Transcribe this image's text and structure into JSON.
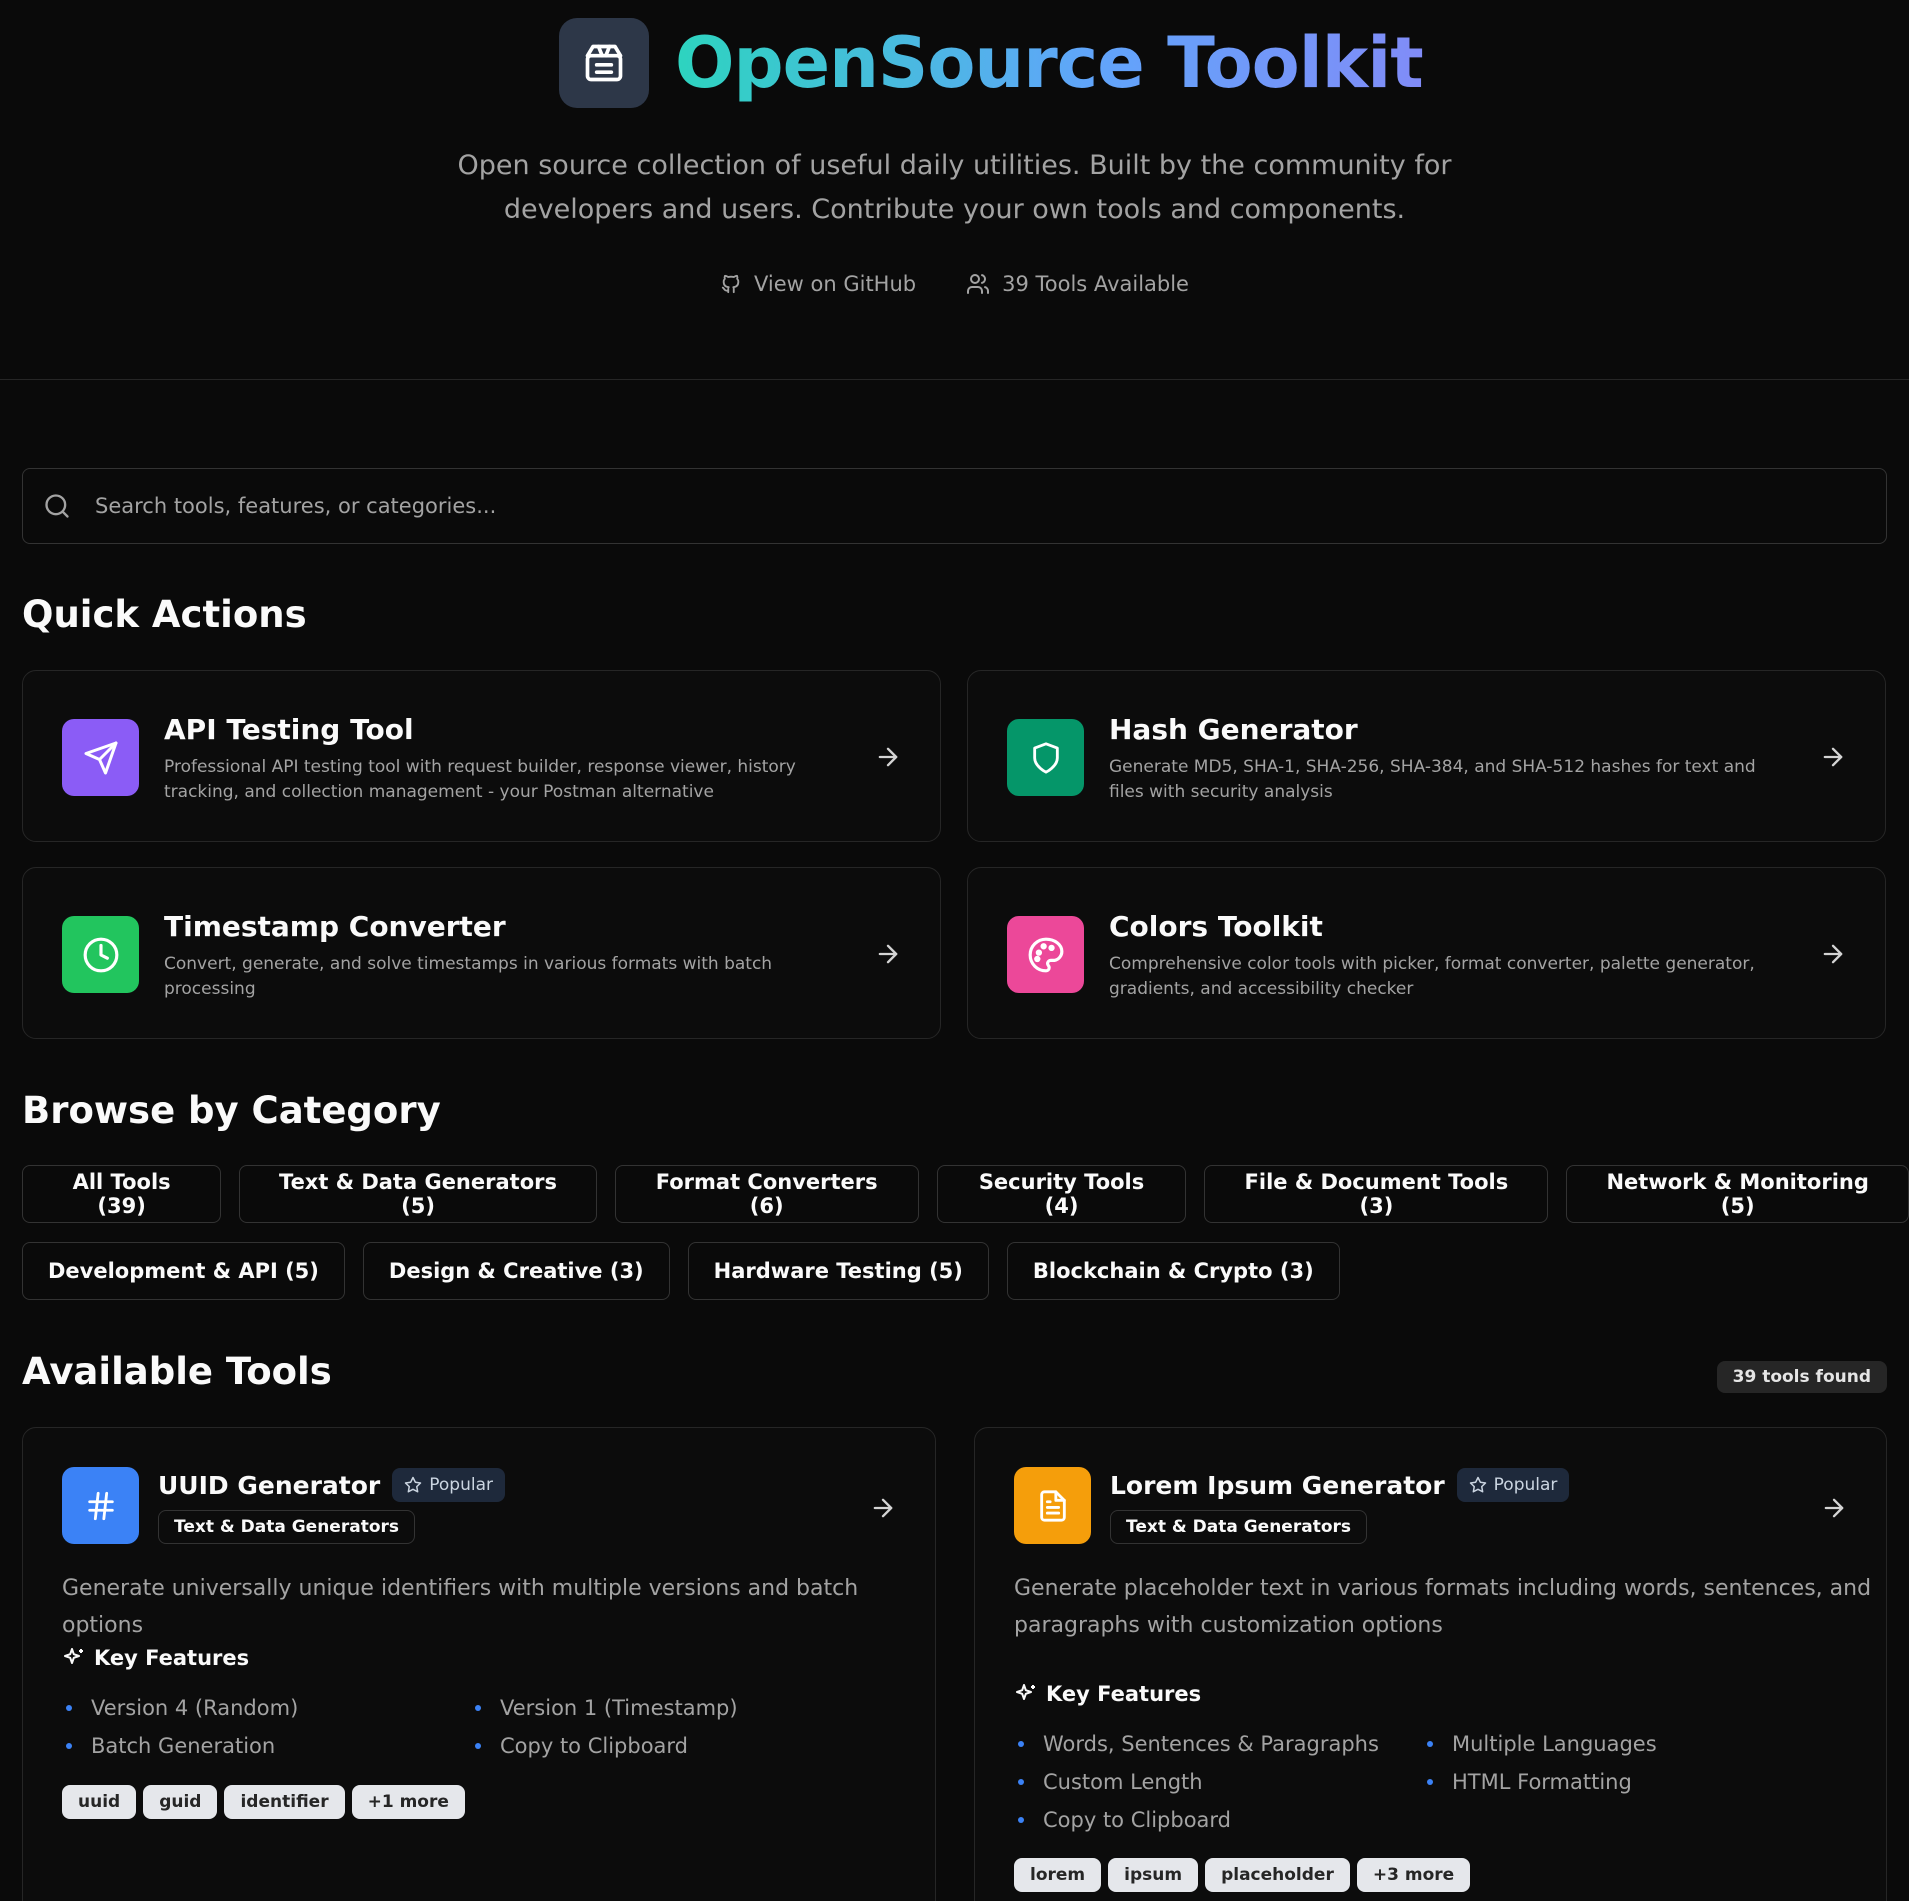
{
  "hero": {
    "title": "OpenSource Toolkit",
    "description": "Open source collection of useful daily utilities. Built by the community for developers and users. Contribute your own tools and components.",
    "github_label": "View on GitHub",
    "tools_available_label": "39 Tools Available",
    "logo_icon": "package-icon",
    "title_gradient": [
      "#2dd4bf",
      "#60a5fa",
      "#818cf8"
    ]
  },
  "search": {
    "placeholder": "Search tools, features, or categories...",
    "value": ""
  },
  "quick_actions": {
    "title": "Quick Actions",
    "items": [
      {
        "title": "API Testing Tool",
        "description": "Professional API testing tool with request builder, response viewer, history tracking, and collection management - your Postman alternative",
        "icon": "send-icon",
        "color": "#8b5cf6"
      },
      {
        "title": "Hash Generator",
        "description": "Generate MD5, SHA-1, SHA-256, SHA-384, and SHA-512 hashes for text and files with security analysis",
        "icon": "shield-icon",
        "color": "#059669"
      },
      {
        "title": "Timestamp Converter",
        "description": "Convert, generate, and solve timestamps in various formats with batch processing",
        "icon": "clock-icon",
        "color": "#22c55e"
      },
      {
        "title": "Colors Toolkit",
        "description": "Comprehensive color tools with picker, format converter, palette generator, gradients, and accessibility checker",
        "icon": "palette-icon",
        "color": "#ec4899"
      }
    ]
  },
  "categories": {
    "title": "Browse by Category",
    "items": [
      "All Tools (39)",
      "Text & Data Generators (5)",
      "Format Converters (6)",
      "Security Tools (4)",
      "File & Document Tools (3)",
      "Network & Monitoring (5)",
      "Development & API (5)",
      "Design & Creative (3)",
      "Hardware Testing (5)",
      "Blockchain & Crypto (3)"
    ]
  },
  "tools": {
    "title": "Available Tools",
    "count_label": "39 tools found",
    "items": [
      {
        "name": "UUID Generator",
        "badge": "Popular",
        "category": "Text & Data Generators",
        "description": "Generate universally unique identifiers with multiple versions and batch options",
        "features_title": "Key Features",
        "features": [
          "Version 4 (Random)",
          "Version 1 (Timestamp)",
          "Batch Generation",
          "Copy to Clipboard"
        ],
        "tags": [
          "uuid",
          "guid",
          "identifier",
          "+1 more"
        ],
        "icon": "hash-icon",
        "color": "#3b82f6"
      },
      {
        "name": "Lorem Ipsum Generator",
        "badge": "Popular",
        "category": "Text & Data Generators",
        "description_line1": "Generate placeholder text in various formats including words, sentences, and",
        "description_line2": "paragraphs with customization options",
        "features_title": "Key Features",
        "features": [
          "Words, Sentences & Paragraphs",
          "Multiple Languages",
          "Custom Length",
          "HTML Formatting",
          "Copy to Clipboard"
        ],
        "tags": [
          "lorem",
          "ipsum",
          "placeholder",
          "+3 more"
        ],
        "icon": "file-text-icon",
        "color": "#f59e0b"
      }
    ]
  }
}
